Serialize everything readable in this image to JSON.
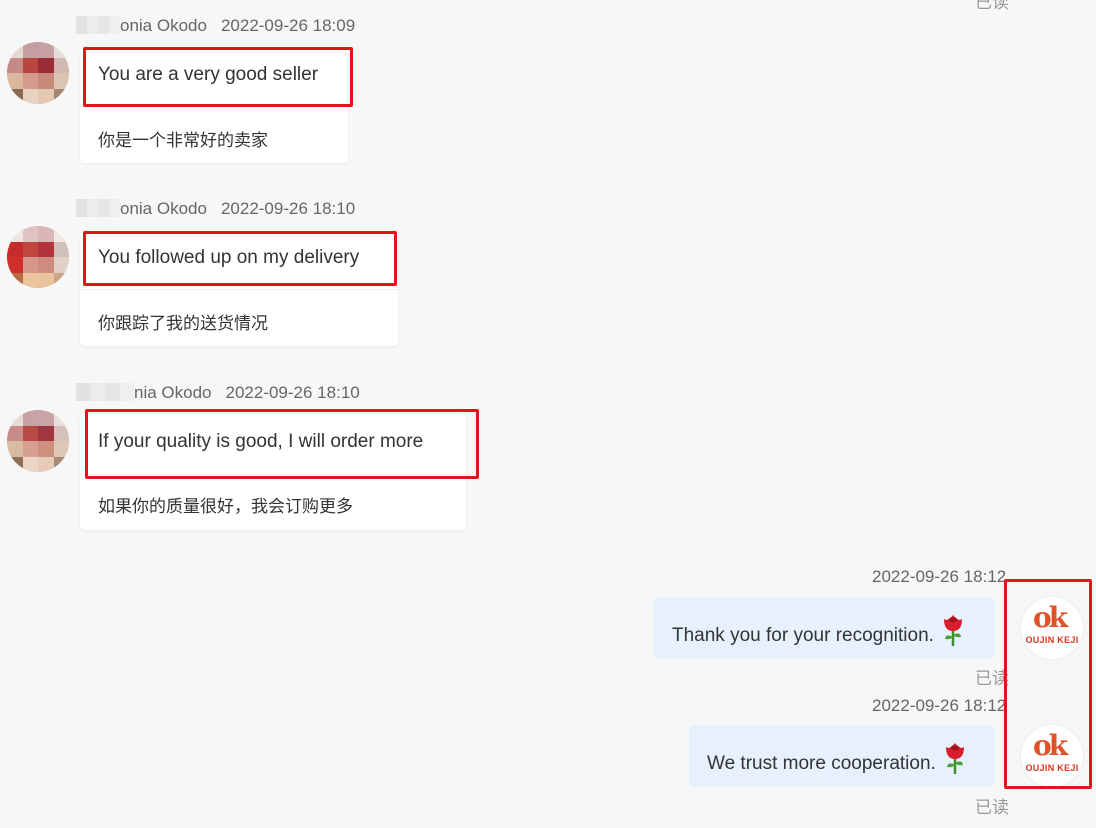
{
  "messages": [
    {
      "sender": "onia Okodo",
      "time": "2022-09-26 18:09",
      "text": "You are a very good seller",
      "translation": "你是一个非常好的卖家"
    },
    {
      "sender": "onia Okodo",
      "time": "2022-09-26 18:10",
      "text": "You followed up on my delivery",
      "translation": "你跟踪了我的送货情况"
    },
    {
      "sender": "nia Okodo",
      "time": "2022-09-26 18:10",
      "text": "If your quality is good, I will order more",
      "translation": "如果你的质量很好，我会订购更多"
    }
  ],
  "replies": [
    {
      "time": "2022-09-26 18:12",
      "text": "Thank you for your recognition.",
      "emoji": "rose-icon",
      "status": "已读"
    },
    {
      "time": "2022-09-26 18:12",
      "text": "We trust more cooperation.",
      "emoji": "rose-icon",
      "status": "已读"
    }
  ],
  "top_status": "已读",
  "seller_logo": {
    "mark": "ok",
    "brand": "OUJIN KEJI"
  },
  "colors": {
    "highlight": "#e3141a",
    "outgoing_bubble": "#e6f1fd",
    "incoming_bubble": "#ffffff",
    "logo": "#e1512a"
  }
}
